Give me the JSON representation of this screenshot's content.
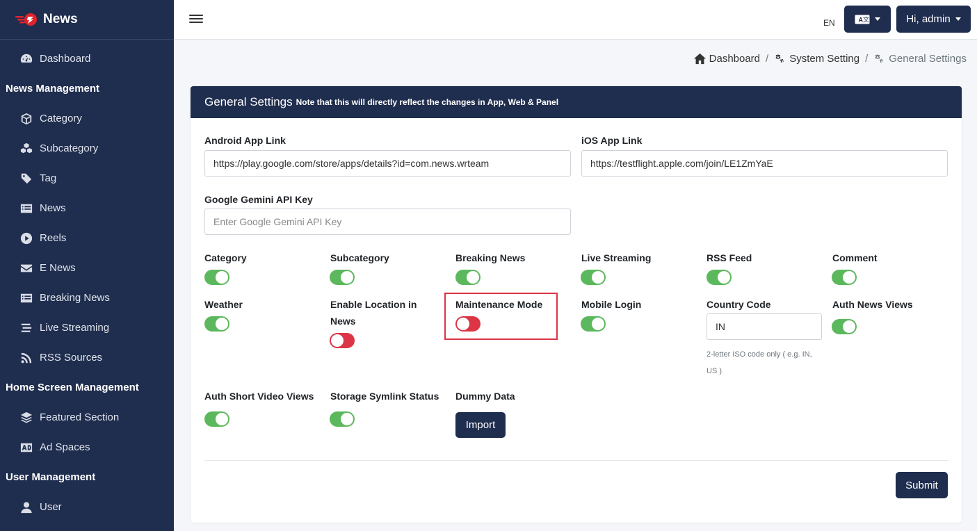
{
  "brand": {
    "name": "News"
  },
  "sidebar": {
    "dashboard": "Dashboard",
    "sections": [
      {
        "header": "News Management",
        "items": [
          "Category",
          "Subcategory",
          "Tag",
          "News",
          "Reels",
          "E News",
          "Breaking News",
          "Live Streaming",
          "RSS Sources"
        ]
      },
      {
        "header": "Home Screen Management",
        "items": [
          "Featured Section",
          "Ad Spaces"
        ]
      },
      {
        "header": "User Management",
        "items": [
          "User"
        ]
      }
    ]
  },
  "topbar": {
    "lang_code": "EN",
    "user_label": "Hi, admin"
  },
  "breadcrumb": {
    "home": "Dashboard",
    "system": "System Setting",
    "current": "General Settings"
  },
  "card": {
    "title": "General Settings",
    "note": "Note that this will directly reflect the changes in App, Web & Panel"
  },
  "form": {
    "android_label": "Android App Link",
    "android_value": "https://play.google.com/store/apps/details?id=com.news.wrteam",
    "ios_label": "iOS App Link",
    "ios_value": "https://testflight.apple.com/join/LE1ZmYaE",
    "gemini_label": "Google Gemini API Key",
    "gemini_placeholder": "Enter Google Gemini API Key",
    "toggles": {
      "category": {
        "label": "Category",
        "on": true
      },
      "subcategory": {
        "label": "Subcategory",
        "on": true
      },
      "breaking_news": {
        "label": "Breaking News",
        "on": true
      },
      "live_streaming": {
        "label": "Live Streaming",
        "on": true
      },
      "rss_feed": {
        "label": "RSS Feed",
        "on": true
      },
      "comment": {
        "label": "Comment",
        "on": true
      },
      "weather": {
        "label": "Weather",
        "on": true
      },
      "enable_location": {
        "label_line1": "Enable Location in",
        "label_line2": "News",
        "on": false
      },
      "maintenance_mode": {
        "label": "Maintenance Mode",
        "on": false
      },
      "mobile_login": {
        "label": "Mobile Login",
        "on": true
      },
      "auth_news_views": {
        "label": "Auth News Views",
        "on": true
      },
      "auth_short_video_views": {
        "label": "Auth Short Video Views",
        "on": true
      },
      "storage_symlink": {
        "label": "Storage Symlink Status",
        "on": true
      }
    },
    "country_code_label": "Country Code",
    "country_code_value": "IN",
    "country_code_help_line1": "2-letter ISO code only ( e.g. IN,",
    "country_code_help_line2": "US )",
    "dummy_data_label": "Dummy Data",
    "import_label": "Import",
    "submit_label": "Submit"
  },
  "colors": {
    "navy": "#1f2d4e",
    "toggle_on": "#5cb85c",
    "toggle_off": "#dc3545",
    "highlight": "#dc3545"
  }
}
